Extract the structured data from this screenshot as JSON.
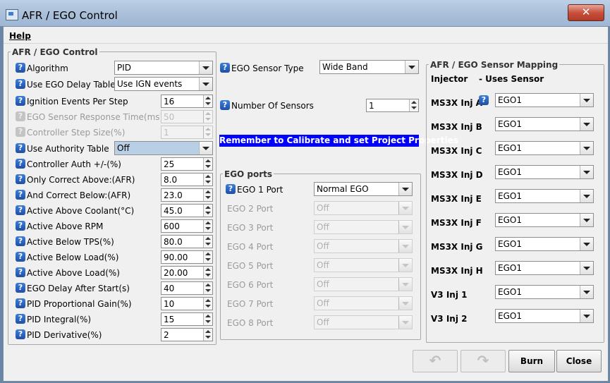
{
  "window": {
    "title": "AFR / EGO Control",
    "close_symbol": "✕"
  },
  "menu": {
    "help": "Help"
  },
  "left_panel": {
    "title": "AFR / EGO Control",
    "rows": [
      {
        "label": "Algorithm",
        "value": "PID"
      },
      {
        "label": "Use EGO Delay Table",
        "value": "Use IGN events"
      },
      {
        "label": "Ignition Events Per Step",
        "value": "16"
      },
      {
        "label": "EGO Sensor Response Time(ms)",
        "value": "50"
      },
      {
        "label": "Controller Step Size(%)",
        "value": "1"
      },
      {
        "label": "Use Authority Table",
        "value": "Off"
      },
      {
        "label": "Controller Auth +/-(%)",
        "value": "25"
      },
      {
        "label": "Only Correct Above:(AFR)",
        "value": "8.0"
      },
      {
        "label": "And Correct Below:(AFR)",
        "value": "23.0"
      },
      {
        "label": "Active Above Coolant(°C)",
        "value": "45.0"
      },
      {
        "label": "Active Above RPM",
        "value": "600"
      },
      {
        "label": "Active Below TPS(%)",
        "value": "80.0"
      },
      {
        "label": "Active Below Load(%)",
        "value": "90.00"
      },
      {
        "label": "Active Above Load(%)",
        "value": "20.00"
      },
      {
        "label": "EGO Delay After Start(s)",
        "value": "40"
      },
      {
        "label": "PID Proportional Gain(%)",
        "value": "10"
      },
      {
        "label": "PID Integral(%)",
        "value": "15"
      },
      {
        "label": "PID Derivative(%)",
        "value": "2"
      }
    ]
  },
  "middle": {
    "sensor_type_label": "EGO Sensor Type",
    "sensor_type_value": "Wide Band",
    "num_sensors_label": "Number Of Sensors",
    "num_sensors_value": "1",
    "notice": "Remember to Calibrate and set Project Properties",
    "ports_title": "EGO ports",
    "ports": [
      {
        "label": "EGO 1 Port",
        "value": "Normal EGO"
      },
      {
        "label": "EGO 2 Port",
        "value": "Off"
      },
      {
        "label": "EGO 3 Port",
        "value": "Off"
      },
      {
        "label": "EGO 4 Port",
        "value": "Off"
      },
      {
        "label": "EGO 5 Port",
        "value": "Off"
      },
      {
        "label": "EGO 6 Port",
        "value": "Off"
      },
      {
        "label": "EGO 7 Port",
        "value": "Off"
      },
      {
        "label": "EGO 8 Port",
        "value": "Off"
      }
    ]
  },
  "mapping": {
    "title": "AFR / EGO Sensor Mapping",
    "col_injector": "Injector",
    "col_sensor": "- Uses Sensor",
    "rows": [
      {
        "label": "MS3X Inj A",
        "value": "EGO1"
      },
      {
        "label": "MS3X Inj B",
        "value": "EGO1"
      },
      {
        "label": "MS3X Inj C",
        "value": "EGO1"
      },
      {
        "label": "MS3X Inj D",
        "value": "EGO1"
      },
      {
        "label": "MS3X Inj E",
        "value": "EGO1"
      },
      {
        "label": "MS3X Inj F",
        "value": "EGO1"
      },
      {
        "label": "MS3X Inj G",
        "value": "EGO1"
      },
      {
        "label": "MS3X Inj H",
        "value": "EGO1"
      },
      {
        "label": "V3 Inj 1",
        "value": "EGO1"
      },
      {
        "label": "V3 Inj 2",
        "value": "EGO1"
      }
    ]
  },
  "footer": {
    "burn": "Burn",
    "close": "Close"
  },
  "icons": {
    "help": "?"
  },
  "colors": {
    "notice_bg": "#0000ff",
    "help_icon": "#2a63c4"
  }
}
